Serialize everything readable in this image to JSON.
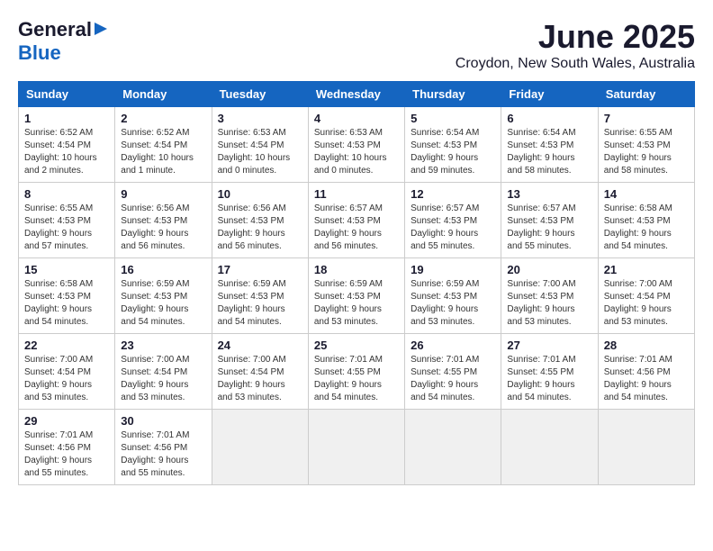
{
  "header": {
    "logo_general": "General",
    "logo_blue": "Blue",
    "month_year": "June 2025",
    "location": "Croydon, New South Wales, Australia"
  },
  "columns": [
    "Sunday",
    "Monday",
    "Tuesday",
    "Wednesday",
    "Thursday",
    "Friday",
    "Saturday"
  ],
  "weeks": [
    [
      {
        "day": "1",
        "info": "Sunrise: 6:52 AM\nSunset: 4:54 PM\nDaylight: 10 hours\nand 2 minutes."
      },
      {
        "day": "2",
        "info": "Sunrise: 6:52 AM\nSunset: 4:54 PM\nDaylight: 10 hours\nand 1 minute."
      },
      {
        "day": "3",
        "info": "Sunrise: 6:53 AM\nSunset: 4:54 PM\nDaylight: 10 hours\nand 0 minutes."
      },
      {
        "day": "4",
        "info": "Sunrise: 6:53 AM\nSunset: 4:53 PM\nDaylight: 10 hours\nand 0 minutes."
      },
      {
        "day": "5",
        "info": "Sunrise: 6:54 AM\nSunset: 4:53 PM\nDaylight: 9 hours\nand 59 minutes."
      },
      {
        "day": "6",
        "info": "Sunrise: 6:54 AM\nSunset: 4:53 PM\nDaylight: 9 hours\nand 58 minutes."
      },
      {
        "day": "7",
        "info": "Sunrise: 6:55 AM\nSunset: 4:53 PM\nDaylight: 9 hours\nand 58 minutes."
      }
    ],
    [
      {
        "day": "8",
        "info": "Sunrise: 6:55 AM\nSunset: 4:53 PM\nDaylight: 9 hours\nand 57 minutes."
      },
      {
        "day": "9",
        "info": "Sunrise: 6:56 AM\nSunset: 4:53 PM\nDaylight: 9 hours\nand 56 minutes."
      },
      {
        "day": "10",
        "info": "Sunrise: 6:56 AM\nSunset: 4:53 PM\nDaylight: 9 hours\nand 56 minutes."
      },
      {
        "day": "11",
        "info": "Sunrise: 6:57 AM\nSunset: 4:53 PM\nDaylight: 9 hours\nand 56 minutes."
      },
      {
        "day": "12",
        "info": "Sunrise: 6:57 AM\nSunset: 4:53 PM\nDaylight: 9 hours\nand 55 minutes."
      },
      {
        "day": "13",
        "info": "Sunrise: 6:57 AM\nSunset: 4:53 PM\nDaylight: 9 hours\nand 55 minutes."
      },
      {
        "day": "14",
        "info": "Sunrise: 6:58 AM\nSunset: 4:53 PM\nDaylight: 9 hours\nand 54 minutes."
      }
    ],
    [
      {
        "day": "15",
        "info": "Sunrise: 6:58 AM\nSunset: 4:53 PM\nDaylight: 9 hours\nand 54 minutes."
      },
      {
        "day": "16",
        "info": "Sunrise: 6:59 AM\nSunset: 4:53 PM\nDaylight: 9 hours\nand 54 minutes."
      },
      {
        "day": "17",
        "info": "Sunrise: 6:59 AM\nSunset: 4:53 PM\nDaylight: 9 hours\nand 54 minutes."
      },
      {
        "day": "18",
        "info": "Sunrise: 6:59 AM\nSunset: 4:53 PM\nDaylight: 9 hours\nand 53 minutes."
      },
      {
        "day": "19",
        "info": "Sunrise: 6:59 AM\nSunset: 4:53 PM\nDaylight: 9 hours\nand 53 minutes."
      },
      {
        "day": "20",
        "info": "Sunrise: 7:00 AM\nSunset: 4:53 PM\nDaylight: 9 hours\nand 53 minutes."
      },
      {
        "day": "21",
        "info": "Sunrise: 7:00 AM\nSunset: 4:54 PM\nDaylight: 9 hours\nand 53 minutes."
      }
    ],
    [
      {
        "day": "22",
        "info": "Sunrise: 7:00 AM\nSunset: 4:54 PM\nDaylight: 9 hours\nand 53 minutes."
      },
      {
        "day": "23",
        "info": "Sunrise: 7:00 AM\nSunset: 4:54 PM\nDaylight: 9 hours\nand 53 minutes."
      },
      {
        "day": "24",
        "info": "Sunrise: 7:00 AM\nSunset: 4:54 PM\nDaylight: 9 hours\nand 53 minutes."
      },
      {
        "day": "25",
        "info": "Sunrise: 7:01 AM\nSunset: 4:55 PM\nDaylight: 9 hours\nand 54 minutes."
      },
      {
        "day": "26",
        "info": "Sunrise: 7:01 AM\nSunset: 4:55 PM\nDaylight: 9 hours\nand 54 minutes."
      },
      {
        "day": "27",
        "info": "Sunrise: 7:01 AM\nSunset: 4:55 PM\nDaylight: 9 hours\nand 54 minutes."
      },
      {
        "day": "28",
        "info": "Sunrise: 7:01 AM\nSunset: 4:56 PM\nDaylight: 9 hours\nand 54 minutes."
      }
    ],
    [
      {
        "day": "29",
        "info": "Sunrise: 7:01 AM\nSunset: 4:56 PM\nDaylight: 9 hours\nand 55 minutes."
      },
      {
        "day": "30",
        "info": "Sunrise: 7:01 AM\nSunset: 4:56 PM\nDaylight: 9 hours\nand 55 minutes."
      },
      {
        "day": "",
        "info": ""
      },
      {
        "day": "",
        "info": ""
      },
      {
        "day": "",
        "info": ""
      },
      {
        "day": "",
        "info": ""
      },
      {
        "day": "",
        "info": ""
      }
    ]
  ]
}
